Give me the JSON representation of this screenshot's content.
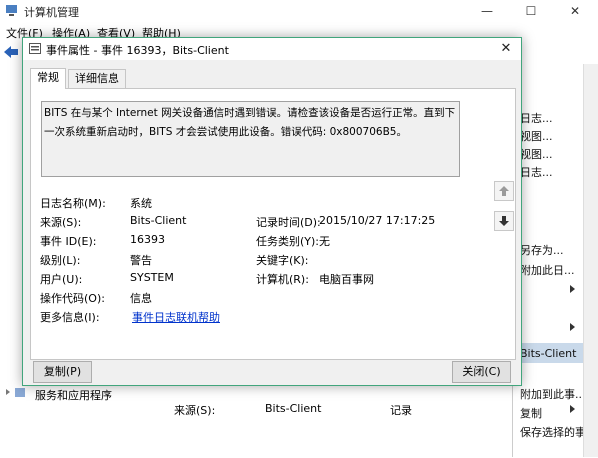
{
  "background_window": {
    "title": "计算机管理",
    "menu": [
      "文件(F)",
      "操作(A)",
      "查看(V)",
      "帮助(H)"
    ],
    "window_controls": [
      "—",
      "☐",
      "✕"
    ],
    "actions": [
      {
        "label": "日志..."
      },
      {
        "label": "视图..."
      },
      {
        "label": "视图..."
      },
      {
        "label": "日志..."
      },
      {
        "label": "另存为..."
      },
      {
        "label": "附加此日..."
      },
      {
        "label": "Bits-Client"
      },
      {
        "label": "附加到此事..."
      },
      {
        "label": "复制"
      },
      {
        "label": "保存选择的事件..."
      }
    ],
    "tree_item": "服务和应用程序",
    "list_preview": {
      "source_label": "来源(S):",
      "source_value": "Bits-Client",
      "record_label": "记录"
    }
  },
  "dialog": {
    "title": "事件属性 - 事件 16393，Bits-Client",
    "tabs": [
      "常规",
      "详细信息"
    ],
    "description": "BITS 在与某个 Internet 网关设备通信时遇到错误。请检查该设备是否运行正常。直到下一次系统重新启动时，BITS 才会尝试使用此设备。错误代码: 0x800706B5。",
    "fields_left": [
      {
        "label": "日志名称(M):",
        "value": "系统"
      },
      {
        "label": "来源(S):",
        "value": "Bits-Client"
      },
      {
        "label": "事件 ID(E):",
        "value": "16393"
      },
      {
        "label": "级别(L):",
        "value": "警告"
      },
      {
        "label": "用户(U):",
        "value": "SYSTEM"
      },
      {
        "label": "操作代码(O):",
        "value": "信息"
      },
      {
        "label": "更多信息(I):",
        "value": "事件日志联机帮助"
      }
    ],
    "fields_right": [
      {
        "label": "记录时间(D):",
        "value": "2015/10/27 17:17:25"
      },
      {
        "label": "任务类别(Y):",
        "value": "无"
      },
      {
        "label": "关键字(K):",
        "value": ""
      },
      {
        "label": "计算机(R):",
        "value": "电脑百事网"
      }
    ],
    "copy_button": "复制(P)",
    "close_button": "关闭(C)"
  },
  "colors": {
    "dialog_border": "#41a57c",
    "link": "#0033cc",
    "selected_action": "#c9d9ea"
  }
}
